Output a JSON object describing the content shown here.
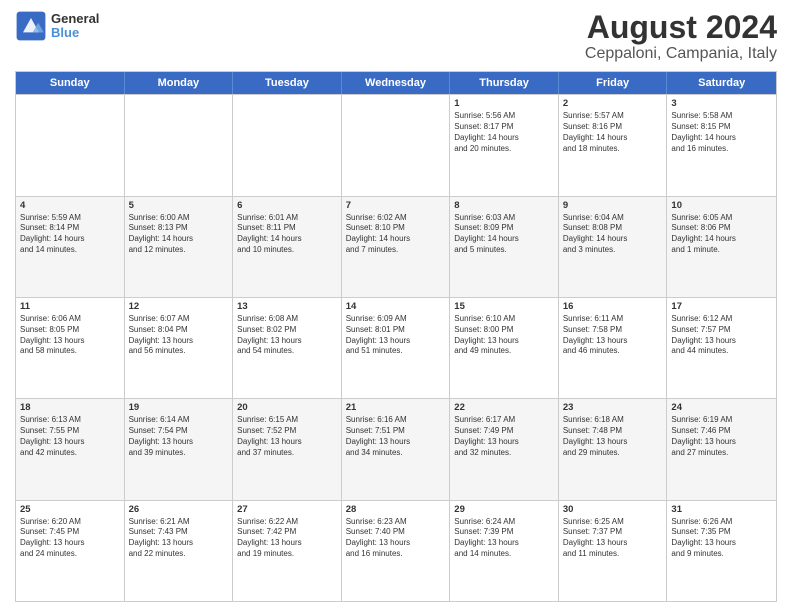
{
  "logo": {
    "line1": "General",
    "line2": "Blue"
  },
  "title": "August 2024",
  "subtitle": "Ceppaloni, Campania, Italy",
  "days": [
    "Sunday",
    "Monday",
    "Tuesday",
    "Wednesday",
    "Thursday",
    "Friday",
    "Saturday"
  ],
  "rows": [
    [
      {
        "day": "",
        "text": ""
      },
      {
        "day": "",
        "text": ""
      },
      {
        "day": "",
        "text": ""
      },
      {
        "day": "",
        "text": ""
      },
      {
        "day": "1",
        "text": "Sunrise: 5:56 AM\nSunset: 8:17 PM\nDaylight: 14 hours\nand 20 minutes."
      },
      {
        "day": "2",
        "text": "Sunrise: 5:57 AM\nSunset: 8:16 PM\nDaylight: 14 hours\nand 18 minutes."
      },
      {
        "day": "3",
        "text": "Sunrise: 5:58 AM\nSunset: 8:15 PM\nDaylight: 14 hours\nand 16 minutes."
      }
    ],
    [
      {
        "day": "4",
        "text": "Sunrise: 5:59 AM\nSunset: 8:14 PM\nDaylight: 14 hours\nand 14 minutes."
      },
      {
        "day": "5",
        "text": "Sunrise: 6:00 AM\nSunset: 8:13 PM\nDaylight: 14 hours\nand 12 minutes."
      },
      {
        "day": "6",
        "text": "Sunrise: 6:01 AM\nSunset: 8:11 PM\nDaylight: 14 hours\nand 10 minutes."
      },
      {
        "day": "7",
        "text": "Sunrise: 6:02 AM\nSunset: 8:10 PM\nDaylight: 14 hours\nand 7 minutes."
      },
      {
        "day": "8",
        "text": "Sunrise: 6:03 AM\nSunset: 8:09 PM\nDaylight: 14 hours\nand 5 minutes."
      },
      {
        "day": "9",
        "text": "Sunrise: 6:04 AM\nSunset: 8:08 PM\nDaylight: 14 hours\nand 3 minutes."
      },
      {
        "day": "10",
        "text": "Sunrise: 6:05 AM\nSunset: 8:06 PM\nDaylight: 14 hours\nand 1 minute."
      }
    ],
    [
      {
        "day": "11",
        "text": "Sunrise: 6:06 AM\nSunset: 8:05 PM\nDaylight: 13 hours\nand 58 minutes."
      },
      {
        "day": "12",
        "text": "Sunrise: 6:07 AM\nSunset: 8:04 PM\nDaylight: 13 hours\nand 56 minutes."
      },
      {
        "day": "13",
        "text": "Sunrise: 6:08 AM\nSunset: 8:02 PM\nDaylight: 13 hours\nand 54 minutes."
      },
      {
        "day": "14",
        "text": "Sunrise: 6:09 AM\nSunset: 8:01 PM\nDaylight: 13 hours\nand 51 minutes."
      },
      {
        "day": "15",
        "text": "Sunrise: 6:10 AM\nSunset: 8:00 PM\nDaylight: 13 hours\nand 49 minutes."
      },
      {
        "day": "16",
        "text": "Sunrise: 6:11 AM\nSunset: 7:58 PM\nDaylight: 13 hours\nand 46 minutes."
      },
      {
        "day": "17",
        "text": "Sunrise: 6:12 AM\nSunset: 7:57 PM\nDaylight: 13 hours\nand 44 minutes."
      }
    ],
    [
      {
        "day": "18",
        "text": "Sunrise: 6:13 AM\nSunset: 7:55 PM\nDaylight: 13 hours\nand 42 minutes."
      },
      {
        "day": "19",
        "text": "Sunrise: 6:14 AM\nSunset: 7:54 PM\nDaylight: 13 hours\nand 39 minutes."
      },
      {
        "day": "20",
        "text": "Sunrise: 6:15 AM\nSunset: 7:52 PM\nDaylight: 13 hours\nand 37 minutes."
      },
      {
        "day": "21",
        "text": "Sunrise: 6:16 AM\nSunset: 7:51 PM\nDaylight: 13 hours\nand 34 minutes."
      },
      {
        "day": "22",
        "text": "Sunrise: 6:17 AM\nSunset: 7:49 PM\nDaylight: 13 hours\nand 32 minutes."
      },
      {
        "day": "23",
        "text": "Sunrise: 6:18 AM\nSunset: 7:48 PM\nDaylight: 13 hours\nand 29 minutes."
      },
      {
        "day": "24",
        "text": "Sunrise: 6:19 AM\nSunset: 7:46 PM\nDaylight: 13 hours\nand 27 minutes."
      }
    ],
    [
      {
        "day": "25",
        "text": "Sunrise: 6:20 AM\nSunset: 7:45 PM\nDaylight: 13 hours\nand 24 minutes."
      },
      {
        "day": "26",
        "text": "Sunrise: 6:21 AM\nSunset: 7:43 PM\nDaylight: 13 hours\nand 22 minutes."
      },
      {
        "day": "27",
        "text": "Sunrise: 6:22 AM\nSunset: 7:42 PM\nDaylight: 13 hours\nand 19 minutes."
      },
      {
        "day": "28",
        "text": "Sunrise: 6:23 AM\nSunset: 7:40 PM\nDaylight: 13 hours\nand 16 minutes."
      },
      {
        "day": "29",
        "text": "Sunrise: 6:24 AM\nSunset: 7:39 PM\nDaylight: 13 hours\nand 14 minutes."
      },
      {
        "day": "30",
        "text": "Sunrise: 6:25 AM\nSunset: 7:37 PM\nDaylight: 13 hours\nand 11 minutes."
      },
      {
        "day": "31",
        "text": "Sunrise: 6:26 AM\nSunset: 7:35 PM\nDaylight: 13 hours\nand 9 minutes."
      }
    ]
  ]
}
